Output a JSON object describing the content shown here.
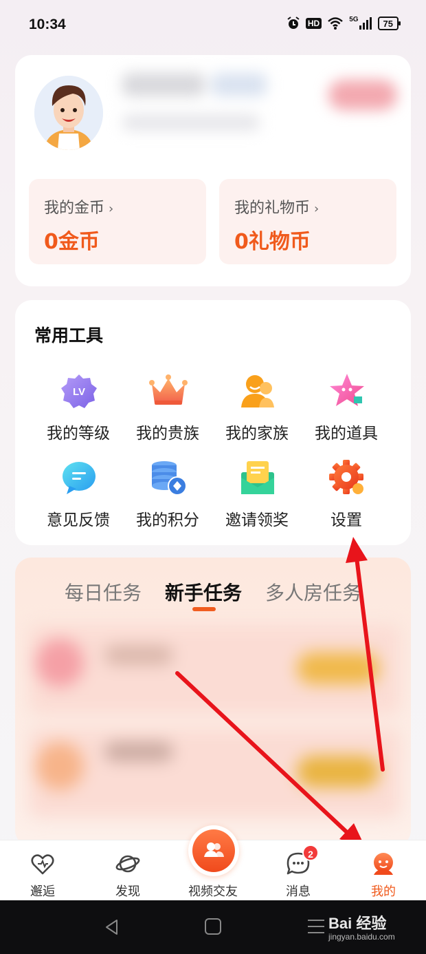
{
  "status_bar": {
    "time": "10:34",
    "icons": [
      "alarm-icon",
      "hd-icon",
      "wifi-icon",
      "5g-signal-icon",
      "battery-icon"
    ],
    "hd": "HD",
    "network": "5G",
    "battery": "75"
  },
  "wallet": {
    "gold": {
      "label": "我的金币",
      "value": "0金币"
    },
    "gift": {
      "label": "我的礼物币",
      "value": "0礼物币"
    },
    "accent_color": "#f05a1c"
  },
  "tools": {
    "title": "常用工具",
    "items": [
      {
        "label": "我的等级",
        "icon": "level-badge-icon"
      },
      {
        "label": "我的贵族",
        "icon": "crown-icon"
      },
      {
        "label": "我的家族",
        "icon": "family-icon"
      },
      {
        "label": "我的道具",
        "icon": "star-prop-icon"
      },
      {
        "label": "意见反馈",
        "icon": "feedback-icon"
      },
      {
        "label": "我的积分",
        "icon": "points-icon"
      },
      {
        "label": "邀请领奖",
        "icon": "invite-envelope-icon"
      },
      {
        "label": "设置",
        "icon": "settings-gear-icon"
      }
    ]
  },
  "tasks": {
    "tabs": [
      {
        "label": "每日任务",
        "active": false
      },
      {
        "label": "新手任务",
        "active": true
      },
      {
        "label": "多人房任务",
        "active": false
      }
    ]
  },
  "tab_bar": {
    "items": [
      {
        "label": "邂逅",
        "icon": "heart-icon",
        "active": false
      },
      {
        "label": "发现",
        "icon": "planet-icon",
        "active": false
      },
      {
        "label": "视频交友",
        "icon": "video-friends-icon",
        "active": false
      },
      {
        "label": "消息",
        "icon": "chat-bubble-icon",
        "active": false,
        "badge": "2"
      },
      {
        "label": "我的",
        "icon": "profile-icon",
        "active": true
      }
    ]
  },
  "watermark": {
    "brand": "Bai 经验",
    "url": "jingyan.baidu.com"
  }
}
